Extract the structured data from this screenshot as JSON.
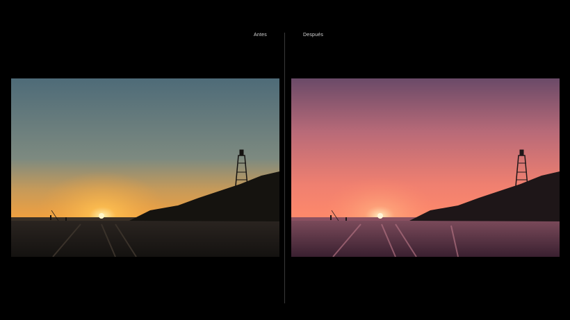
{
  "comparison": {
    "before_label": "Antes",
    "after_label": "Después"
  },
  "colors": {
    "background": "#000000",
    "before_sky_top": "#4e6b78",
    "before_sky_horizon": "#f0a040",
    "after_sky_top": "#6a4a68",
    "after_sky_horizon": "#ff8a6a"
  }
}
